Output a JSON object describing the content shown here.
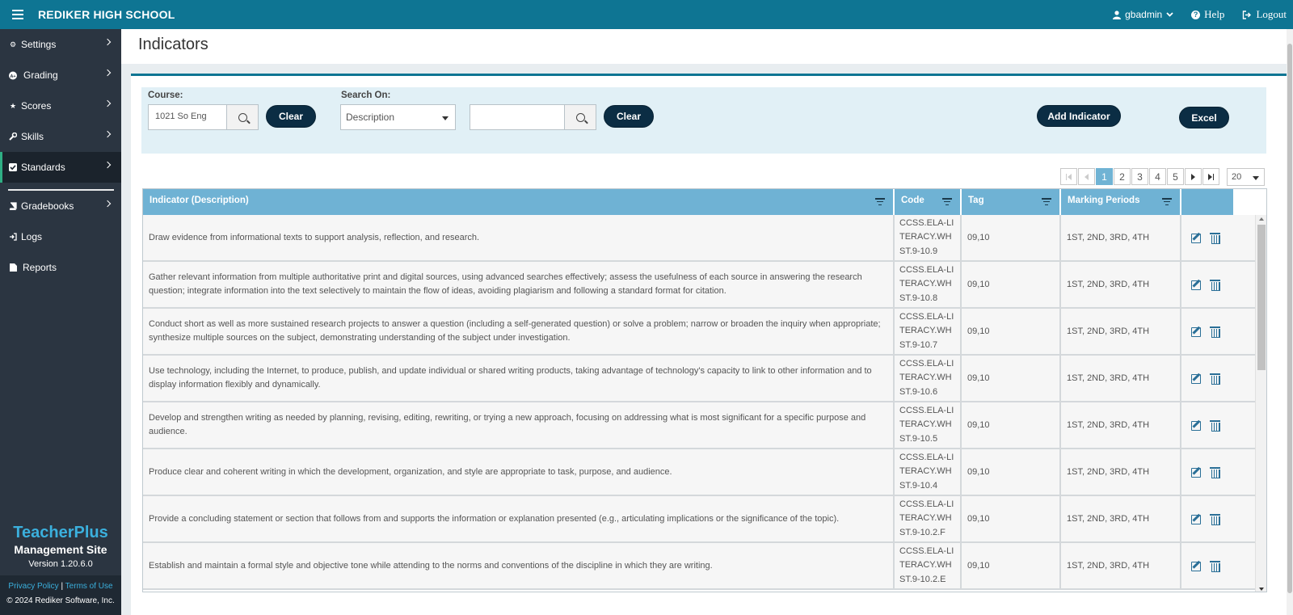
{
  "header": {
    "school_name": "REDIKER HIGH SCHOOL",
    "user": "gbadmin",
    "help_label": "Help",
    "logout_label": "Logout"
  },
  "sidebar": {
    "items": [
      {
        "label": "Settings",
        "icon": "gear-icon"
      },
      {
        "label": "Grading",
        "icon": "grading-icon"
      },
      {
        "label": "Scores",
        "icon": "star-icon"
      },
      {
        "label": "Skills",
        "icon": "wrench-icon"
      },
      {
        "label": "Standards",
        "icon": "checkbox-icon",
        "active": true
      },
      {
        "label": "Gradebooks",
        "icon": "book-icon"
      },
      {
        "label": "Logs",
        "icon": "sign-in-icon"
      },
      {
        "label": "Reports",
        "icon": "file-icon"
      }
    ],
    "brand_name": "TeacherPlus",
    "brand_sub": "Management Site",
    "version": "Version 1.20.6.0",
    "privacy_label": "Privacy Policy",
    "separator": "|",
    "terms_label": "Terms of Use",
    "copyright": "© 2024 Rediker Software, Inc."
  },
  "page": {
    "title": "Indicators"
  },
  "search": {
    "course_label": "Course:",
    "course_value": "1021 So Eng",
    "clear_label": "Clear",
    "search_on_label": "Search On:",
    "search_on_value": "Description",
    "search_text_value": "",
    "clear2_label": "Clear",
    "add_label": "Add Indicator",
    "excel_label": "Excel"
  },
  "pager": {
    "pages": [
      "1",
      "2",
      "3",
      "4",
      "5"
    ],
    "current": "1",
    "page_size": "20"
  },
  "table": {
    "columns": [
      "Indicator (Description)",
      "Code",
      "Tag",
      "Marking Periods"
    ],
    "rows": [
      {
        "description": "Draw evidence from informational texts to support analysis, reflection, and research.",
        "code": "CCSS.ELA-LI\nTERACY.WH\nST.9-10.9",
        "tag": "09,10",
        "periods": "1ST, 2ND, 3RD, 4TH"
      },
      {
        "description": "Gather relevant information from multiple authoritative print and digital sources, using advanced searches effectively; assess the usefulness of each source in answering the research question; integrate information into the text selectively to maintain the flow of ideas, avoiding plagiarism and following a standard format for citation.",
        "code": "CCSS.ELA-LI\nTERACY.WH\nST.9-10.8",
        "tag": "09,10",
        "periods": "1ST, 2ND, 3RD, 4TH"
      },
      {
        "description": "Conduct short as well as more sustained research projects to answer a question (including a self-generated question) or solve a problem; narrow or broaden the inquiry when appropriate; synthesize multiple sources on the subject, demonstrating understanding of the subject under investigation.",
        "code": "CCSS.ELA-LI\nTERACY.WH\nST.9-10.7",
        "tag": "09,10",
        "periods": "1ST, 2ND, 3RD, 4TH"
      },
      {
        "description": "Use technology, including the Internet, to produce, publish, and update individual or shared writing products, taking advantage of technology's capacity to link to other information and to display information flexibly and dynamically.",
        "code": "CCSS.ELA-LI\nTERACY.WH\nST.9-10.6",
        "tag": "09,10",
        "periods": "1ST, 2ND, 3RD, 4TH"
      },
      {
        "description": "Develop and strengthen writing as needed by planning, revising, editing, rewriting, or trying a new approach, focusing on addressing what is most significant for a specific purpose and audience.",
        "code": "CCSS.ELA-LI\nTERACY.WH\nST.9-10.5",
        "tag": "09,10",
        "periods": "1ST, 2ND, 3RD, 4TH"
      },
      {
        "description": "Produce clear and coherent writing in which the development, organization, and style are appropriate to task, purpose, and audience.",
        "code": "CCSS.ELA-LI\nTERACY.WH\nST.9-10.4",
        "tag": "09,10",
        "periods": "1ST, 2ND, 3RD, 4TH"
      },
      {
        "description": "Provide a concluding statement or section that follows from and supports the information or explanation presented (e.g., articulating implications or the significance of the topic).",
        "code": "CCSS.ELA-LI\nTERACY.WH\nST.9-10.2.F",
        "tag": "09,10",
        "periods": "1ST, 2ND, 3RD, 4TH"
      },
      {
        "description": "Establish and maintain a formal style and objective tone while attending to the norms and conventions of the discipline in which they are writing.",
        "code": "CCSS.ELA-LI\nTERACY.WH\nST.9-10.2.E",
        "tag": "09,10",
        "periods": "1ST, 2ND, 3RD, 4TH"
      }
    ]
  },
  "colors": {
    "topbar": "#0e7593",
    "sidebar": "#2b3541",
    "header_row": "#6fb2d4",
    "dark_button": "#0b2d44",
    "brand": "#3bb0dd"
  }
}
